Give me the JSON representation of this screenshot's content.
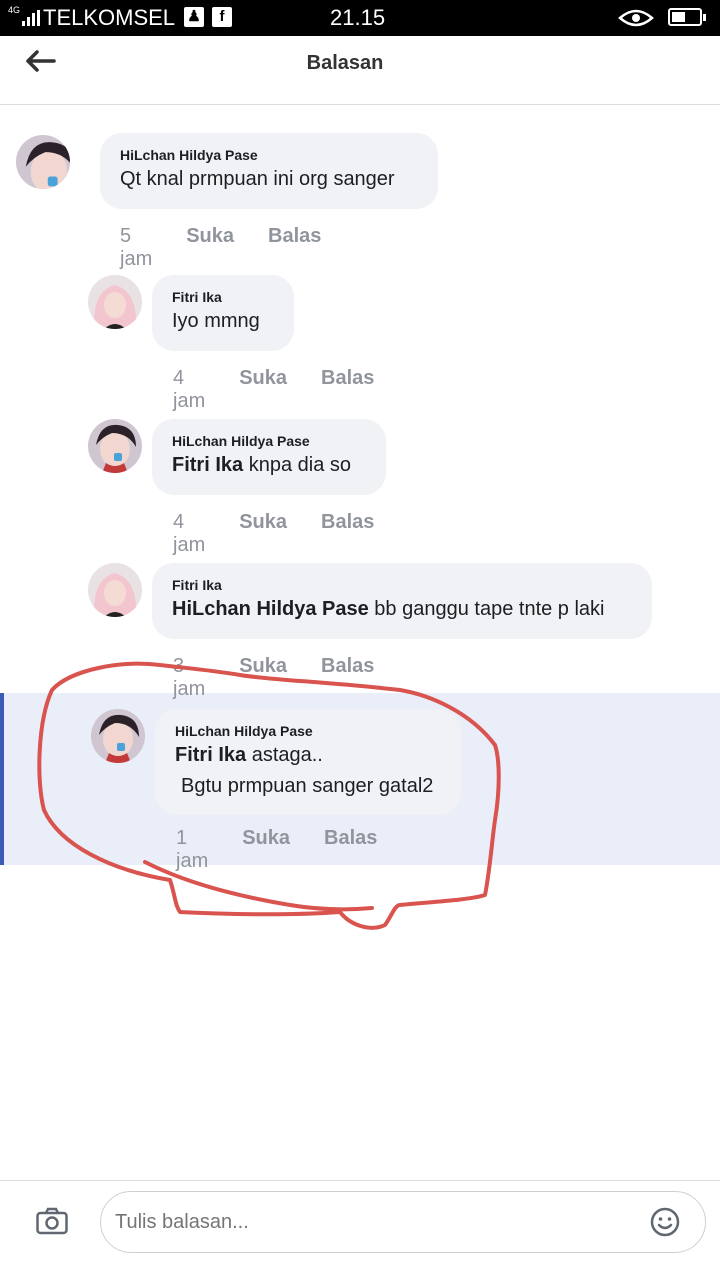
{
  "status_bar": {
    "network": "4G",
    "carrier": "TELKOMSEL",
    "time": "21.15",
    "battery_level": 0.5,
    "colors": {
      "background": "#000000",
      "foreground": "#ffffff"
    }
  },
  "header": {
    "title": "Balasan",
    "back_icon": "arrow-left-icon"
  },
  "comments": [
    {
      "author": "HiLchan Hildya Pase",
      "mention": "",
      "text": "Qt knal prmpuan ini org sanger",
      "text2": "",
      "time": "5 jam",
      "like": "Suka",
      "reply": "Balas"
    },
    {
      "author": "Fitri Ika",
      "mention": "",
      "text": "Iyo mmng",
      "text2": "",
      "time": "4 jam",
      "like": "Suka",
      "reply": "Balas"
    },
    {
      "author": "HiLchan Hildya Pase",
      "mention": "Fitri Ika",
      "text": " knpa dia so",
      "text2": "",
      "time": "4 jam",
      "like": "Suka",
      "reply": "Balas"
    },
    {
      "author": "Fitri Ika",
      "mention": "HiLchan Hildya Pase",
      "text": " bb ganggu tape tnte p laki",
      "text2": "",
      "time": "3 jam",
      "like": "Suka",
      "reply": "Balas"
    },
    {
      "author": "HiLchan Hildya Pase",
      "mention": "Fitri Ika",
      "text": " astaga..",
      "text2": "Bgtu prmpuan sanger gatal2",
      "time": "1 jam",
      "like": "Suka",
      "reply": "Balas",
      "highlighted": true
    }
  ],
  "reply_bar": {
    "placeholder": "Tulis balasan...",
    "camera_icon": "camera-icon",
    "emoji_icon": "smiley-icon"
  },
  "colors": {
    "bubble": "#f0f2f5",
    "highlight": "#e9eef8",
    "highlight_border": "#3b5bb5",
    "meta_text": "#90949c",
    "annotation": "#d9534f"
  }
}
